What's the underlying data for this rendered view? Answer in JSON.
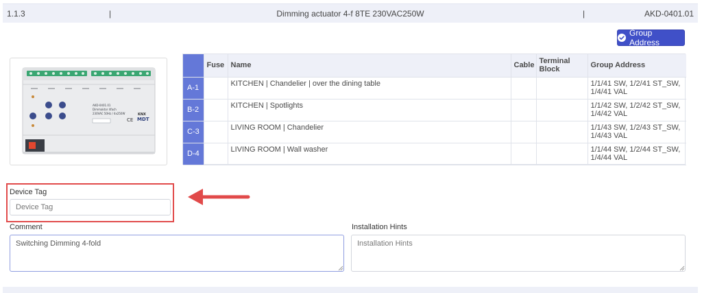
{
  "header": {
    "number": "1.1.3",
    "separator": "|",
    "title": "Dimming actuator 4-f 8TE 230VAC250W",
    "code": "AKD-0401.01"
  },
  "actions": {
    "group_address_label": "Group Address"
  },
  "device": {
    "module_text_line1": "AKD-0401.01",
    "module_text_line2": "Dimmaktor 4fach",
    "module_text_line3": "230VAC 50Hz / 4x250W",
    "brand_knx": "KNX",
    "brand_mdt": "MDT",
    "ce_mark": "CE"
  },
  "table": {
    "columns": [
      "",
      "Fuse",
      "Name",
      "Cable",
      "Terminal Block",
      "Group Address"
    ],
    "rows": [
      {
        "id": "A-1",
        "fuse": "",
        "name": "KITCHEN | Chandelier | over the dining table",
        "cable": "",
        "terminal": "",
        "ga_line1": "1/1/41 SW, 1/2/41 ST_SW,",
        "ga_line2": "1/4/41 VAL"
      },
      {
        "id": "B-2",
        "fuse": "",
        "name": "KITCHEN | Spotlights",
        "cable": "",
        "terminal": "",
        "ga_line1": "1/1/42 SW, 1/2/42 ST_SW,",
        "ga_line2": "1/4/42 VAL"
      },
      {
        "id": "C-3",
        "fuse": "",
        "name": "LIVING ROOM | Chandelier",
        "cable": "",
        "terminal": "",
        "ga_line1": "1/1/43 SW, 1/2/43 ST_SW,",
        "ga_line2": "1/4/43 VAL"
      },
      {
        "id": "D-4",
        "fuse": "",
        "name": "LIVING ROOM | Wall washer",
        "cable": "",
        "terminal": "",
        "ga_line1": "1/1/44 SW, 1/2/44 ST_SW,",
        "ga_line2": "1/4/44 VAL"
      }
    ]
  },
  "form": {
    "device_tag_label": "Device Tag",
    "device_tag_placeholder": "Device Tag",
    "comment_label": "Comment",
    "comment_value": "Switching Dimming 4-fold",
    "hints_label": "Installation Hints",
    "hints_placeholder": "Installation Hints"
  },
  "colors": {
    "accent": "#4050c8",
    "row_id_bg": "#6478d8",
    "highlight": "#e14a4a",
    "header_bg": "#eef0f8"
  },
  "icons": {
    "button_icon": "check-circle-icon",
    "annotation": "red-arrow-icon"
  }
}
